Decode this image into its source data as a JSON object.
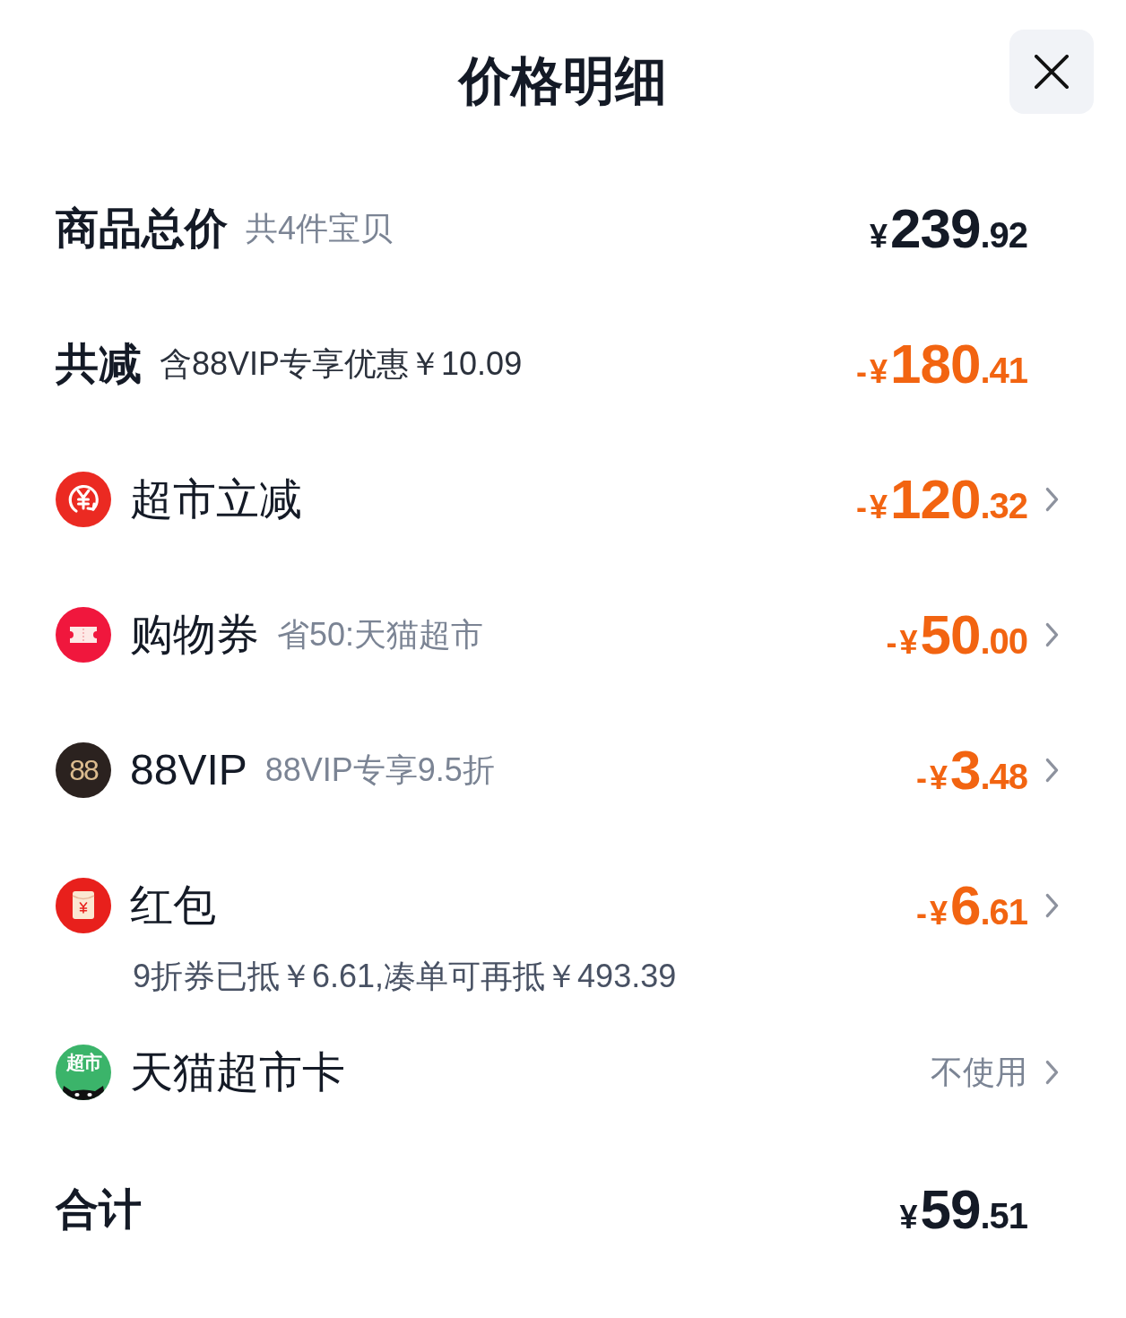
{
  "header": {
    "title": "价格明细"
  },
  "rows": [
    {
      "kind": "subtotal",
      "label": "商品总价",
      "note": "共4件宝贝",
      "amount": "¥239.92"
    },
    {
      "kind": "savings",
      "label": "共减",
      "note": "含88VIP专享优惠￥10.09",
      "amount": "-¥180.41"
    },
    {
      "kind": "markdown",
      "label": "超市立减",
      "amount": "-¥120.32"
    },
    {
      "kind": "coupon",
      "label": "购物券",
      "note": "省50:天猫超市",
      "amount": "-¥50.00"
    },
    {
      "kind": "membership",
      "label": "88VIP",
      "note": "88VIP专享9.5折",
      "amount": "-¥3.48",
      "logo_text": "88"
    },
    {
      "kind": "redpacket",
      "label": "红包",
      "amount": "-¥6.61",
      "detail": "9折券已抵￥6.61,凑单可再抵￥493.39"
    },
    {
      "kind": "giftcard",
      "label": "天猫超市卡",
      "value": "不使用",
      "logo_text": "超市"
    }
  ],
  "total": {
    "label": "合计",
    "amount": "¥59.51"
  }
}
